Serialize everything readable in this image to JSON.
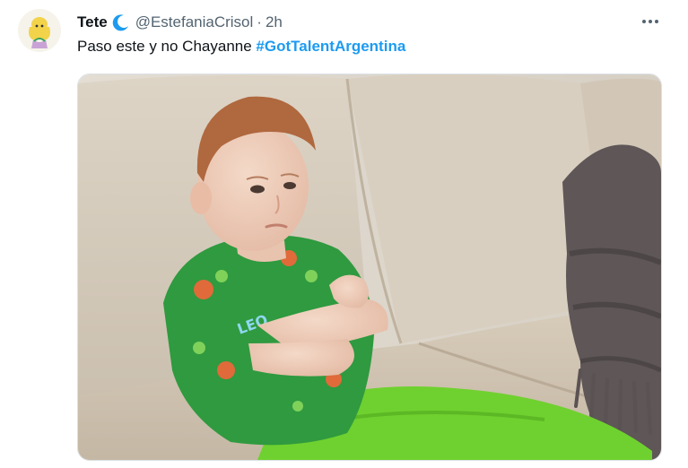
{
  "tweet": {
    "display_name": "Tete",
    "handle": "@EstefaniaCrisol",
    "separator": "·",
    "time": "2h",
    "more_icon": "more-horizontal-icon",
    "text_plain": "Paso este y no Chayanne ",
    "hashtag": "#GotTalentArgentina",
    "shirt_label": "LEO"
  },
  "colors": {
    "hashtag": "#1d9bf0",
    "name": "#0f1419",
    "secondary": "#536471"
  }
}
